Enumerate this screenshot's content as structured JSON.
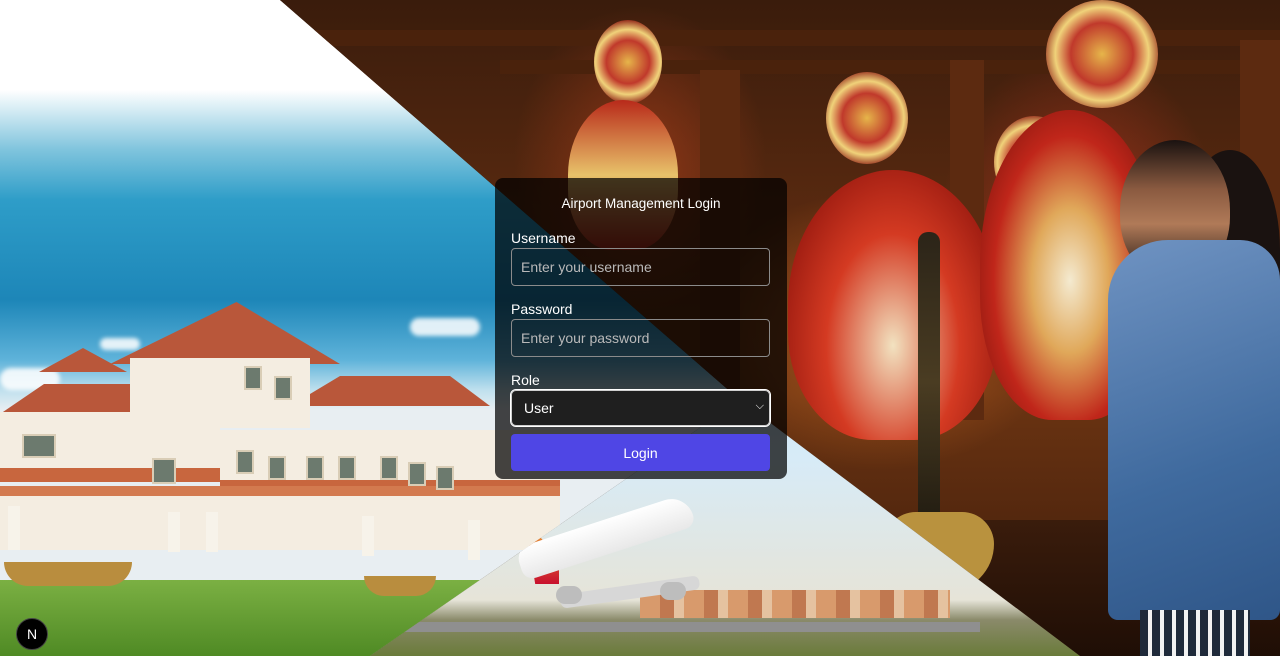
{
  "login": {
    "title": "Airport Management Login",
    "username_label": "Username",
    "username_placeholder": "Enter your username",
    "password_label": "Password",
    "password_placeholder": "Enter your password",
    "role_label": "Role",
    "role_selected": "User",
    "submit_label": "Login"
  },
  "badge": {
    "letter": "N"
  },
  "colors": {
    "button": "#4f46e5",
    "card": "rgba(0,0,0,0.72)"
  },
  "icons": {
    "select": "chevron-down-icon",
    "badge": "next-logo-icon"
  }
}
